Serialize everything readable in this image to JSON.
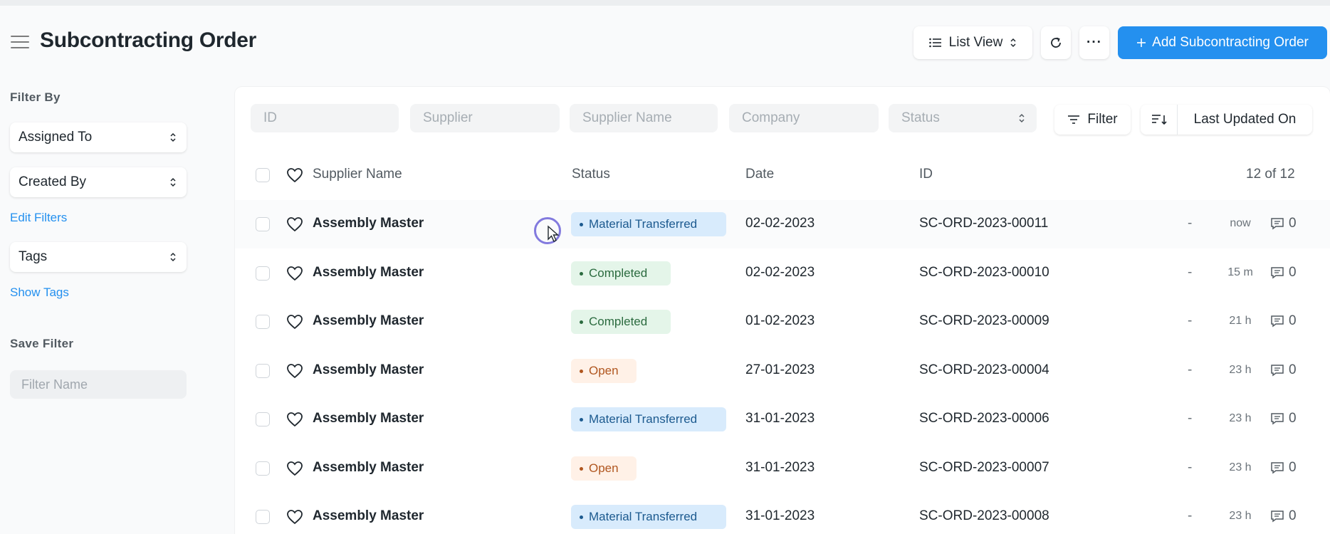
{
  "header": {
    "title": "Subcontracting Order",
    "list_view_label": "List View",
    "more_label": "···",
    "add_label": "Add Subcontracting Order"
  },
  "sidebar": {
    "filter_by_label": "Filter By",
    "assigned_to": "Assigned To",
    "created_by": "Created By",
    "edit_filters": "Edit Filters",
    "tags": "Tags",
    "show_tags": "Show Tags",
    "save_filter_label": "Save Filter",
    "filter_name_placeholder": "Filter Name"
  },
  "filters": {
    "id_placeholder": "ID",
    "supplier_placeholder": "Supplier",
    "supplier_name_placeholder": "Supplier Name",
    "company_placeholder": "Company",
    "status_placeholder": "Status",
    "filter_button": "Filter",
    "sort_field": "Last Updated On"
  },
  "table": {
    "columns": {
      "supplier_name": "Supplier Name",
      "status": "Status",
      "date": "Date",
      "id": "ID"
    },
    "count": "12 of 12",
    "rows": [
      {
        "supplier": "Assembly Master",
        "status": "Material Transferred",
        "status_color": "blue",
        "date": "02-02-2023",
        "id": "SC-ORD-2023-00011",
        "dash": "-",
        "since": "now",
        "comments": "0"
      },
      {
        "supplier": "Assembly Master",
        "status": "Completed",
        "status_color": "green",
        "date": "02-02-2023",
        "id": "SC-ORD-2023-00010",
        "dash": "-",
        "since": "15 m",
        "comments": "0"
      },
      {
        "supplier": "Assembly Master",
        "status": "Completed",
        "status_color": "green",
        "date": "01-02-2023",
        "id": "SC-ORD-2023-00009",
        "dash": "-",
        "since": "21 h",
        "comments": "0"
      },
      {
        "supplier": "Assembly Master",
        "status": "Open",
        "status_color": "orange",
        "date": "27-01-2023",
        "id": "SC-ORD-2023-00004",
        "dash": "-",
        "since": "23 h",
        "comments": "0"
      },
      {
        "supplier": "Assembly Master",
        "status": "Material Transferred",
        "status_color": "blue",
        "date": "31-01-2023",
        "id": "SC-ORD-2023-00006",
        "dash": "-",
        "since": "23 h",
        "comments": "0"
      },
      {
        "supplier": "Assembly Master",
        "status": "Open",
        "status_color": "orange",
        "date": "31-01-2023",
        "id": "SC-ORD-2023-00007",
        "dash": "-",
        "since": "23 h",
        "comments": "0"
      },
      {
        "supplier": "Assembly Master",
        "status": "Material Transferred",
        "status_color": "blue",
        "date": "31-01-2023",
        "id": "SC-ORD-2023-00008",
        "dash": "-",
        "since": "23 h",
        "comments": "0"
      }
    ]
  },
  "colors": {
    "accent": "#2490ef",
    "status_blue_bg": "#d8ebfc",
    "status_green_bg": "#e4f5e9",
    "status_orange_bg": "#fff1e7"
  },
  "icons": [
    "menu-icon",
    "list-icon",
    "sort-arrows-icon",
    "refresh-icon",
    "plus-icon",
    "filter-icon",
    "sort-order-icon",
    "heart-icon",
    "comment-icon"
  ]
}
